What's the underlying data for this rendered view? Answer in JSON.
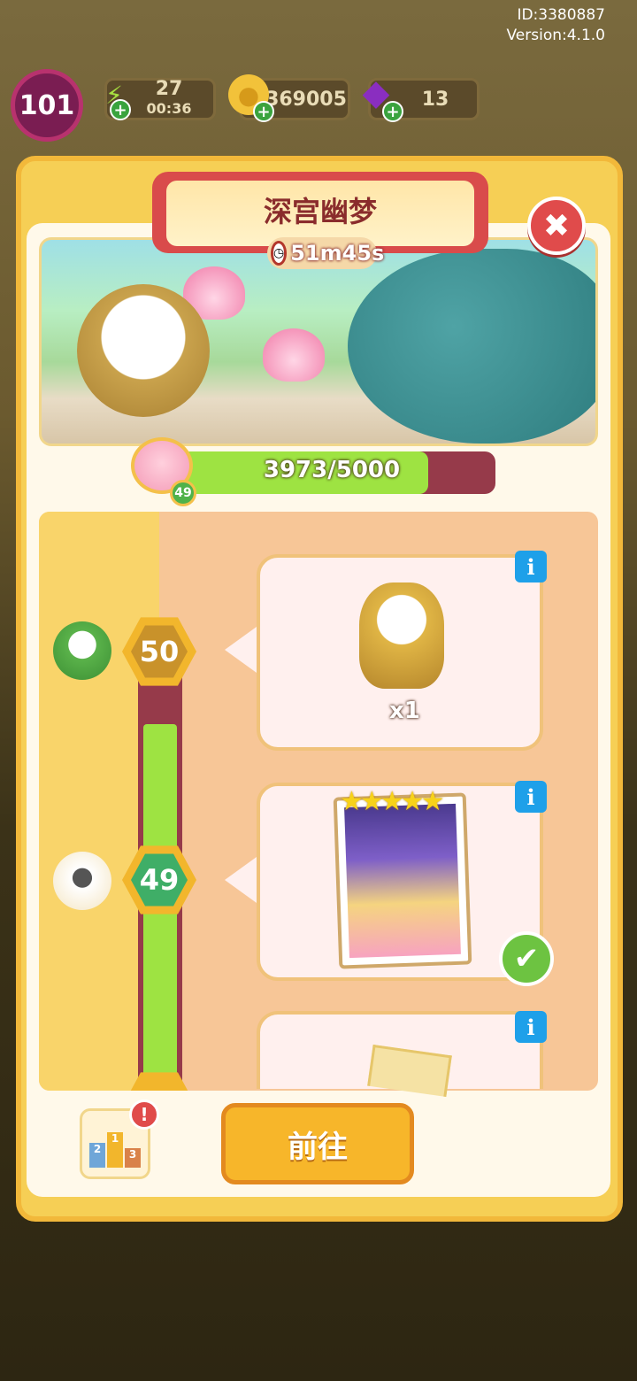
{
  "hud": {
    "user_id": "ID:3380887",
    "version": "Version:4.1.0",
    "level": "101",
    "energy": "27",
    "energy_timer": "00:36",
    "coins": "369005",
    "gems": "13"
  },
  "event": {
    "title": "深宫幽梦",
    "timer": "51m45s",
    "progress_text": "3973/5000",
    "progress_fraction": 0.7946,
    "progress_level": "49"
  },
  "milestones": [
    {
      "level": "50",
      "reward_qty": "x1",
      "claimed": false
    },
    {
      "level": "49",
      "reward_stars": "★★★★★",
      "claimed": true
    }
  ],
  "icons": {
    "close": "✖",
    "info": "i",
    "check": "✔",
    "clock": "◷",
    "plus": "+",
    "energy": "⚡",
    "coin": "●",
    "gem": "◆",
    "alert": "!"
  },
  "footer": {
    "go_label": "前往",
    "rank_1": "1",
    "rank_2": "2",
    "rank_3": "3"
  }
}
